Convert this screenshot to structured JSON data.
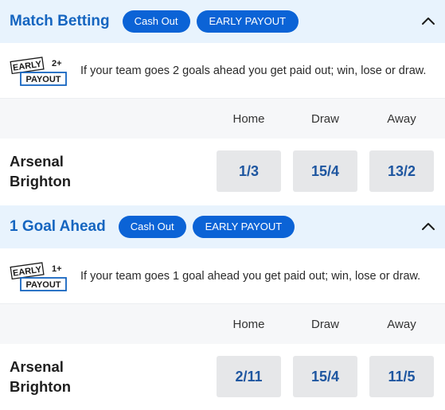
{
  "markets": [
    {
      "title": "Match Betting",
      "cash_out_label": "Cash Out",
      "early_payout_label": "EARLY PAYOUT",
      "badge": {
        "top": "EARLY",
        "goals": "2+",
        "bottom": "PAYOUT"
      },
      "info": "If your team goes 2 goals ahead you get paid out; win, lose or draw.",
      "columns": [
        "Home",
        "Draw",
        "Away"
      ],
      "event": {
        "home": "Arsenal",
        "away": "Brighton"
      },
      "odds": [
        "1/3",
        "15/4",
        "13/2"
      ],
      "collapse_icon": "chevron-up-icon"
    },
    {
      "title": "1 Goal Ahead",
      "cash_out_label": "Cash Out",
      "early_payout_label": "EARLY PAYOUT",
      "badge": {
        "top": "EARLY",
        "goals": "1+",
        "bottom": "PAYOUT"
      },
      "info": "If your team goes 1 goal ahead you get paid out; win, lose or draw.",
      "columns": [
        "Home",
        "Draw",
        "Away"
      ],
      "event": {
        "home": "Arsenal",
        "away": "Brighton"
      },
      "odds": [
        "2/11",
        "15/4",
        "11/5"
      ],
      "collapse_icon": "chevron-up-icon"
    }
  ],
  "colors": {
    "accent": "#1565c0",
    "pill": "#0b63d6",
    "header_bg": "#e8f3fd",
    "odds_bg": "#e6e7e9",
    "odds_text": "#1e56a0"
  }
}
